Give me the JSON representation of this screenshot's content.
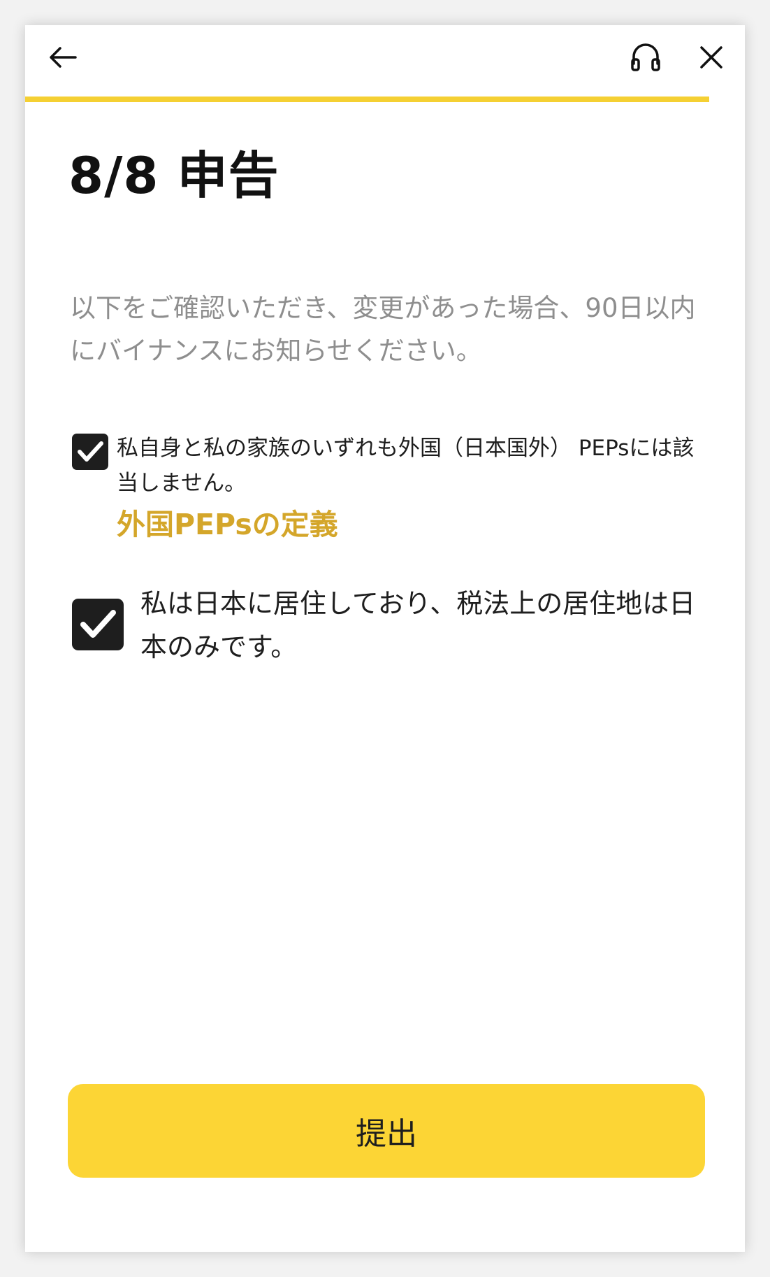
{
  "header": {
    "back_icon": "arrow-left-icon",
    "support_icon": "headset-icon",
    "close_icon": "close-icon",
    "progress_percent": 95,
    "accent_color": "#f5d033"
  },
  "title": "8/8 申告",
  "notice": "以下をご確認いただき、変更があった場合、90日以内にバイナンスにお知らせください。",
  "declarations": [
    {
      "checked": true,
      "label": "私自身と私の家族のいずれも外国（日本国外） PEPsには該当しません。"
    },
    {
      "checked": true,
      "label": "私は日本に居住しており、税法上の居住地は日本のみです。"
    }
  ],
  "pep_link": "外国PEPsの定義",
  "submit": {
    "label": "提出",
    "color": "#fcd535"
  }
}
